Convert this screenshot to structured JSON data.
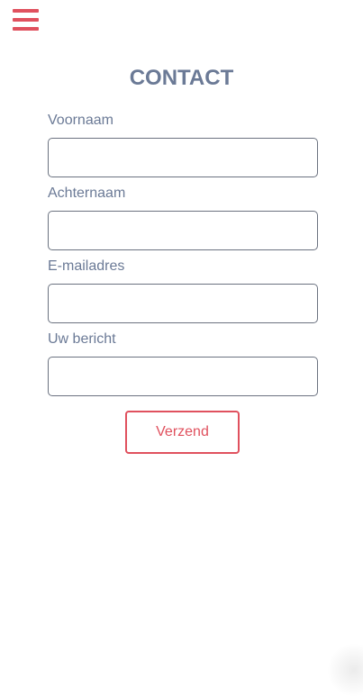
{
  "header": {
    "menu_icon": "hamburger-menu-icon"
  },
  "page": {
    "title": "CONTACT"
  },
  "form": {
    "fields": [
      {
        "label": "Voornaam",
        "value": "",
        "placeholder": ""
      },
      {
        "label": "Achternaam",
        "value": "",
        "placeholder": ""
      },
      {
        "label": "E-mailadres",
        "value": "",
        "placeholder": ""
      },
      {
        "label": "Uw bericht",
        "value": "",
        "placeholder": ""
      }
    ],
    "submit_label": "Verzend"
  },
  "colors": {
    "accent": "#e0515e",
    "text": "#6b7a96",
    "border": "#6b7280",
    "background": "#ffffff"
  }
}
